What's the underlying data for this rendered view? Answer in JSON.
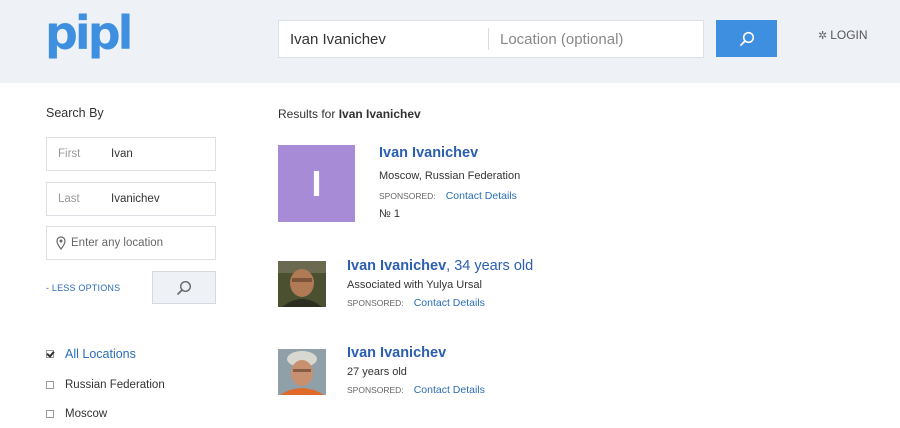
{
  "header": {
    "logo": "pipl",
    "search_name_value": "Ivan Ivanichev",
    "search_location_placeholder": "Location (optional)",
    "login_label": "LOGIN"
  },
  "sidebar": {
    "search_by_label": "Search By",
    "first_label": "First",
    "first_value": "Ivan",
    "last_label": "Last",
    "last_value": "Ivanichev",
    "location_placeholder": "Enter any location",
    "less_options_label": "- LESS OPTIONS",
    "location_filters": [
      {
        "label": "All Locations",
        "checked": true
      },
      {
        "label": "Russian Federation",
        "checked": false
      },
      {
        "label": "Moscow",
        "checked": false
      }
    ]
  },
  "results": {
    "prefix": "Results for ",
    "query": "Ivan Ivanichev",
    "items": [
      {
        "avatar_letter": "I",
        "name": "Ivan Ivanichev",
        "age": "",
        "line1": "Moscow, Russian Federation",
        "sponsored": "SPONSORED:",
        "contact": "Contact Details",
        "line3": "№ 1"
      },
      {
        "name": "Ivan Ivanichev",
        "age": ", 34 years old",
        "line1": "Associated with Yulya Ursal",
        "sponsored": "SPONSORED:",
        "contact": "Contact Details"
      },
      {
        "name": "Ivan Ivanichev",
        "age": "",
        "line1": "27 years old",
        "sponsored": "SPONSORED:",
        "contact": "Contact Details"
      }
    ]
  },
  "colors": {
    "brand": "#3f8fe0",
    "link": "#2b5fb0",
    "avatar": "#a88bd6"
  }
}
